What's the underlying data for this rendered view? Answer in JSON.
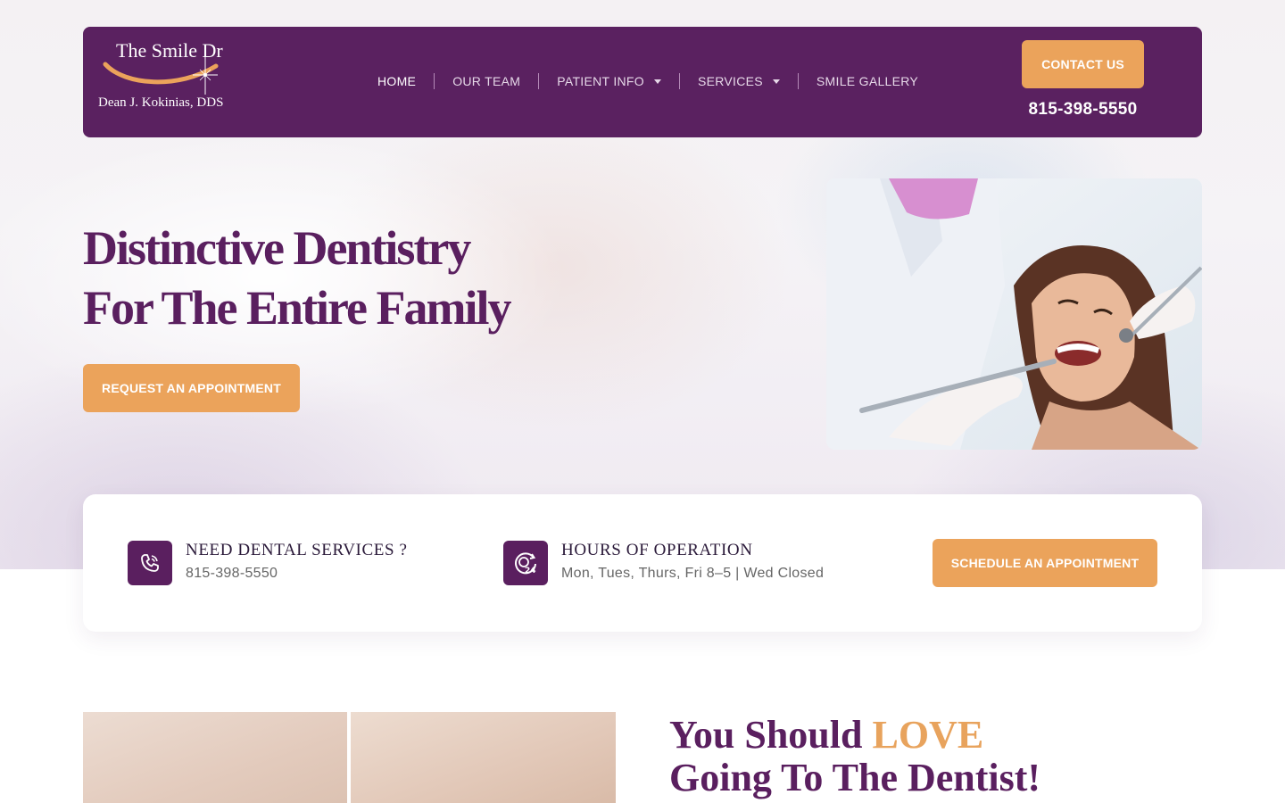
{
  "header": {
    "logo": {
      "line1": "The Smile Dr",
      "line2": "Dean J. Kokinias, DDS"
    },
    "nav": [
      {
        "label": "HOME",
        "active": true,
        "dropdown": false
      },
      {
        "label": "OUR TEAM",
        "active": false,
        "dropdown": false
      },
      {
        "label": "PATIENT INFO",
        "active": false,
        "dropdown": true
      },
      {
        "label": "SERVICES",
        "active": false,
        "dropdown": true
      },
      {
        "label": "SMILE GALLERY",
        "active": false,
        "dropdown": false
      }
    ],
    "contact_button": "CONTACT US",
    "phone": "815-398-5550"
  },
  "hero": {
    "title_line1": "Distinctive Dentistry",
    "title_line2": "For The Entire Family",
    "cta": "REQUEST AN APPOINTMENT"
  },
  "info_card": {
    "services": {
      "icon": "phone-icon",
      "title": "NEED DENTAL SERVICES ?",
      "text": "815-398-5550"
    },
    "hours": {
      "icon": "clock-24-icon",
      "title": "HOURS OF OPERATION",
      "text": "Mon, Tues, Thurs, Fri 8–5 | Wed Closed"
    },
    "cta": "SCHEDULE AN APPOINTMENT"
  },
  "love_section": {
    "line1_prefix": "You Should ",
    "line1_accent": "LOVE",
    "line2": "Going To The Dentist!"
  },
  "colors": {
    "brand_purple": "#5a2160",
    "accent_orange": "#eba35b",
    "title_purple": "#5a1f5f"
  }
}
